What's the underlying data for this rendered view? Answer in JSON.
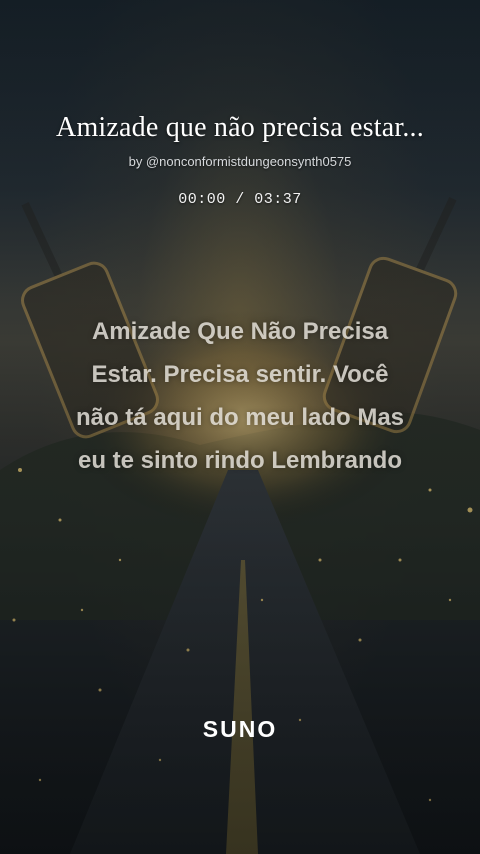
{
  "song": {
    "title": "Amizade que não precisa estar...",
    "author": "by @nonconformistdungeonsynth0575",
    "time_display": "00:00 / 03:37"
  },
  "lyrics": {
    "lines": [
      "Amizade Que Não Precisa",
      "Estar. Precisa sentir. Você",
      "não tá aqui do meu lado Mas",
      "eu te sinto rindo  Lembrando"
    ]
  },
  "brand": {
    "logo_text": "SUNO"
  },
  "colors": {
    "text": "#ffffff",
    "glow": "#d8b060",
    "background": "#1a1f24"
  }
}
